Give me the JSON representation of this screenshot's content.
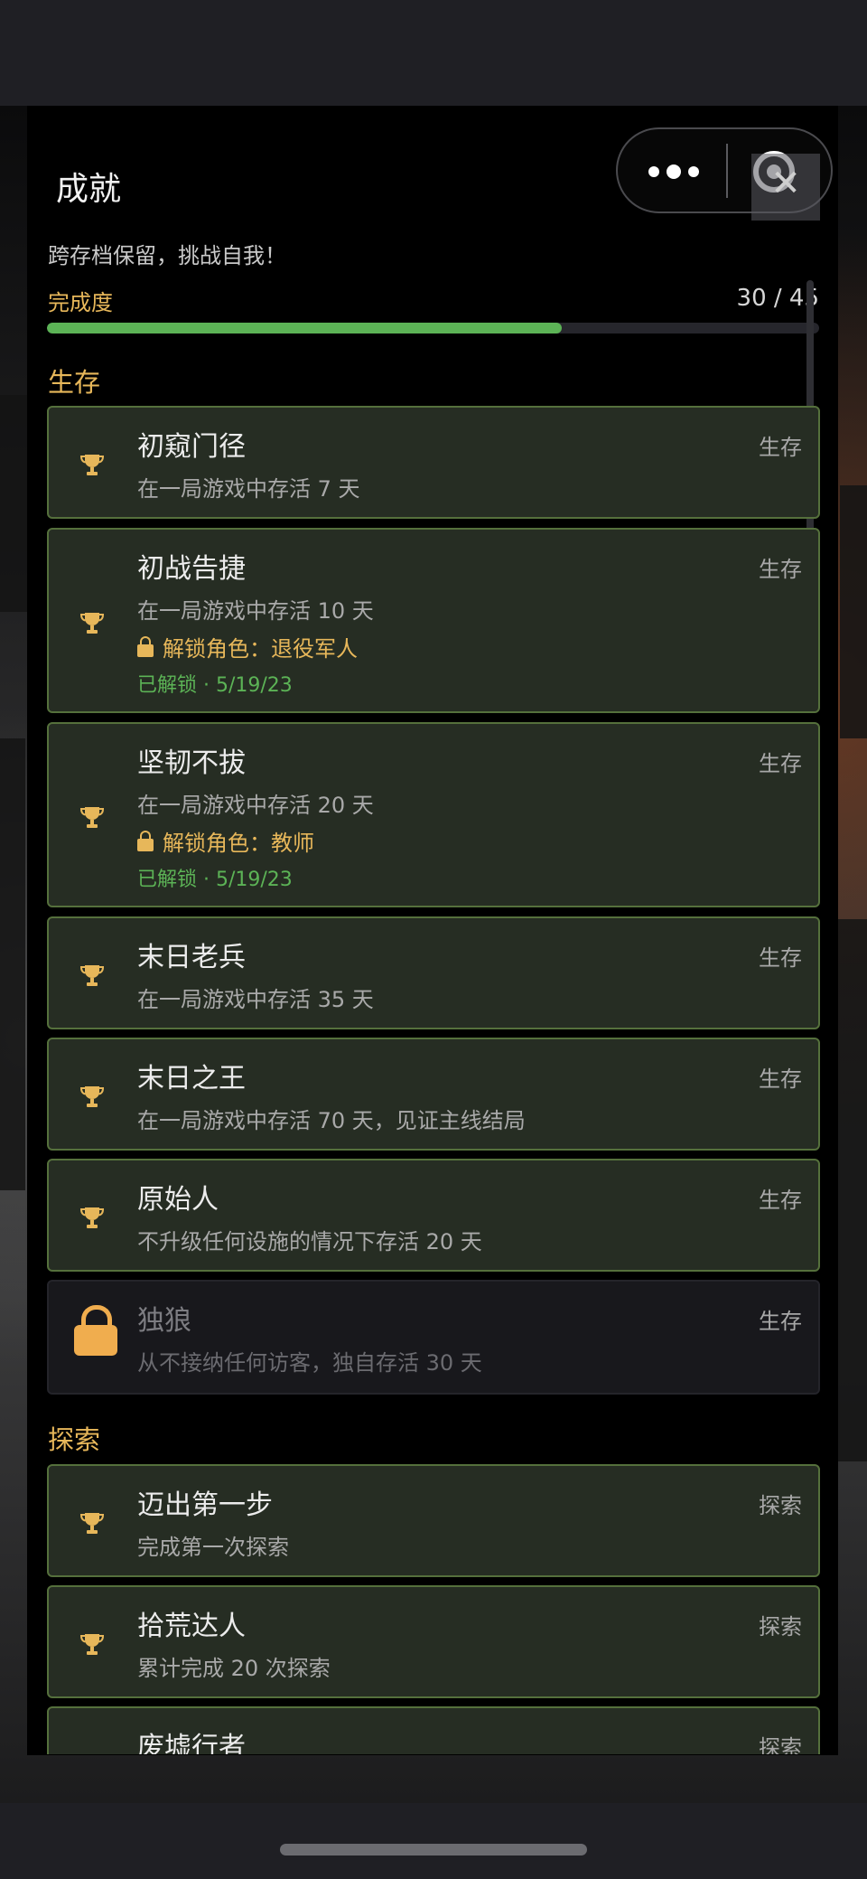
{
  "header": {
    "title": "成就",
    "subtitle": "跨存档保留，挑战自我！"
  },
  "progress": {
    "label": "完成度",
    "count_text": "30 / 45",
    "completed": 30,
    "total": 45
  },
  "sections": [
    {
      "title": "生存"
    },
    {
      "title": "探索"
    }
  ],
  "achievements": [
    {
      "name": "初窥门径",
      "category": "生存",
      "description": "在一局游戏中存活 7 天",
      "reward": "",
      "unlocked_text": "",
      "locked": false
    },
    {
      "name": "初战告捷",
      "category": "生存",
      "description": "在一局游戏中存活 10 天",
      "reward": "解锁角色：退役军人",
      "unlocked_text": "已解锁 · 5/19/23",
      "locked": false
    },
    {
      "name": "坚韧不拔",
      "category": "生存",
      "description": "在一局游戏中存活 20 天",
      "reward": "解锁角色：教师",
      "unlocked_text": "已解锁 · 5/19/23",
      "locked": false
    },
    {
      "name": "末日老兵",
      "category": "生存",
      "description": "在一局游戏中存活 35 天",
      "reward": "",
      "unlocked_text": "",
      "locked": false
    },
    {
      "name": "末日之王",
      "category": "生存",
      "description": "在一局游戏中存活 70 天，见证主线结局",
      "reward": "",
      "unlocked_text": "",
      "locked": false
    },
    {
      "name": "原始人",
      "category": "生存",
      "description": "不升级任何设施的情况下存活 20 天",
      "reward": "",
      "unlocked_text": "",
      "locked": false
    },
    {
      "name": "独狼",
      "category": "生存",
      "description": "从不接纳任何访客，独自存活 30 天",
      "reward": "",
      "unlocked_text": "",
      "locked": true
    },
    {
      "name": "迈出第一步",
      "category": "探索",
      "description": "完成第一次探索",
      "reward": "",
      "unlocked_text": "",
      "locked": false
    },
    {
      "name": "拾荒达人",
      "category": "探索",
      "description": "累计完成 20 次探索",
      "reward": "",
      "unlocked_text": "",
      "locked": false
    },
    {
      "name": "废墟行者",
      "category": "探索",
      "description": "",
      "reward": "",
      "unlocked_text": "",
      "locked": false
    }
  ],
  "icons": {
    "trophy": "trophy-icon",
    "padlock": "padlock-icon",
    "more": "more-dots-icon",
    "target": "target-icon",
    "close": "close-icon"
  },
  "colors": {
    "accent_gold": "#e7b75a",
    "progress_green": "#5cb356",
    "card_bg": "#262d23",
    "card_border": "#55703c",
    "locked_card_bg": "#18181c",
    "lock_orange": "#f0ad4e"
  }
}
